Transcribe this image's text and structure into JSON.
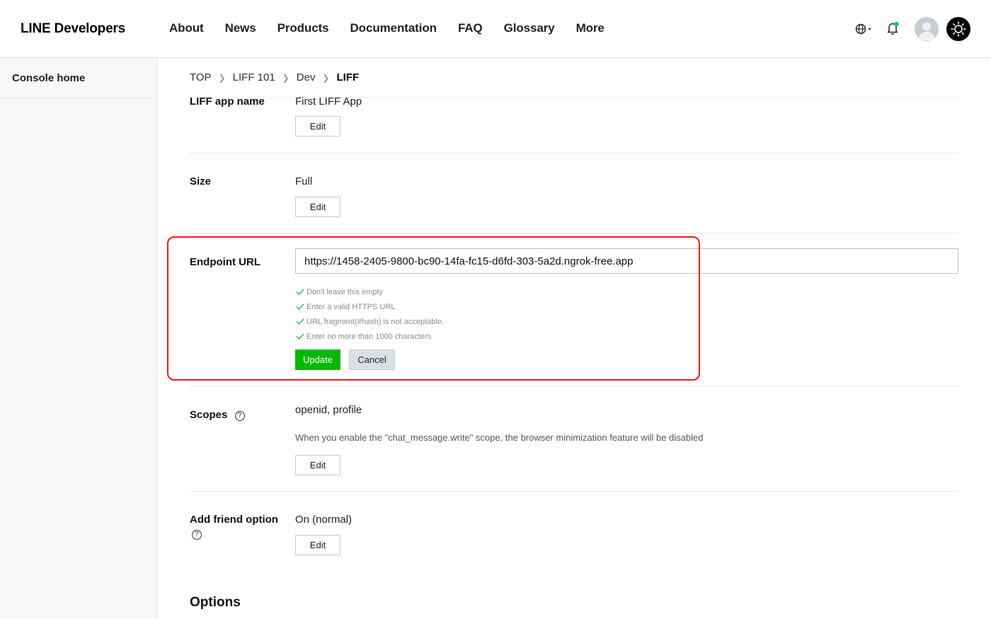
{
  "header": {
    "logo": "LINE Developers",
    "nav": [
      "About",
      "News",
      "Products",
      "Documentation",
      "FAQ",
      "Glossary",
      "More"
    ],
    "icons": {
      "language": "globe-icon",
      "notifications": "bell-icon",
      "avatar": "user-avatar-icon",
      "theme": "sun-icon"
    },
    "notification_dot_color": "#06c755"
  },
  "sidebar": {
    "items": [
      {
        "label": "Console home"
      }
    ]
  },
  "breadcrumb": {
    "items": [
      "TOP",
      "LIFF 101",
      "Dev",
      "LIFF"
    ]
  },
  "fields": {
    "app_name": {
      "label": "LIFF app name",
      "value": "First LIFF App",
      "edit": "Edit"
    },
    "size": {
      "label": "Size",
      "value": "Full",
      "edit": "Edit"
    },
    "endpoint": {
      "label": "Endpoint URL",
      "value": "https://1458-2405-9800-bc90-14fa-fc15-d6fd-303-5a2d.ngrok-free.app",
      "validations": [
        "Don't leave this empty",
        "Enter a valid HTTPS URL",
        "URL fragment(#hash) is not acceptable.",
        "Enter no more than 1000 characters"
      ],
      "update": "Update",
      "cancel": "Cancel"
    },
    "scopes": {
      "label": "Scopes",
      "help": "?",
      "value": "openid, profile",
      "note": "When you enable the \"chat_message.write\" scope, the browser minimization feature will be disabled",
      "edit": "Edit"
    },
    "add_friend": {
      "label": "Add friend option",
      "help": "?",
      "value": "On (normal)",
      "edit": "Edit"
    }
  },
  "options_title": "Options",
  "colors": {
    "accent_green": "#06b800",
    "highlight_red": "#ee1b1b",
    "check_green": "#2bb14a"
  }
}
